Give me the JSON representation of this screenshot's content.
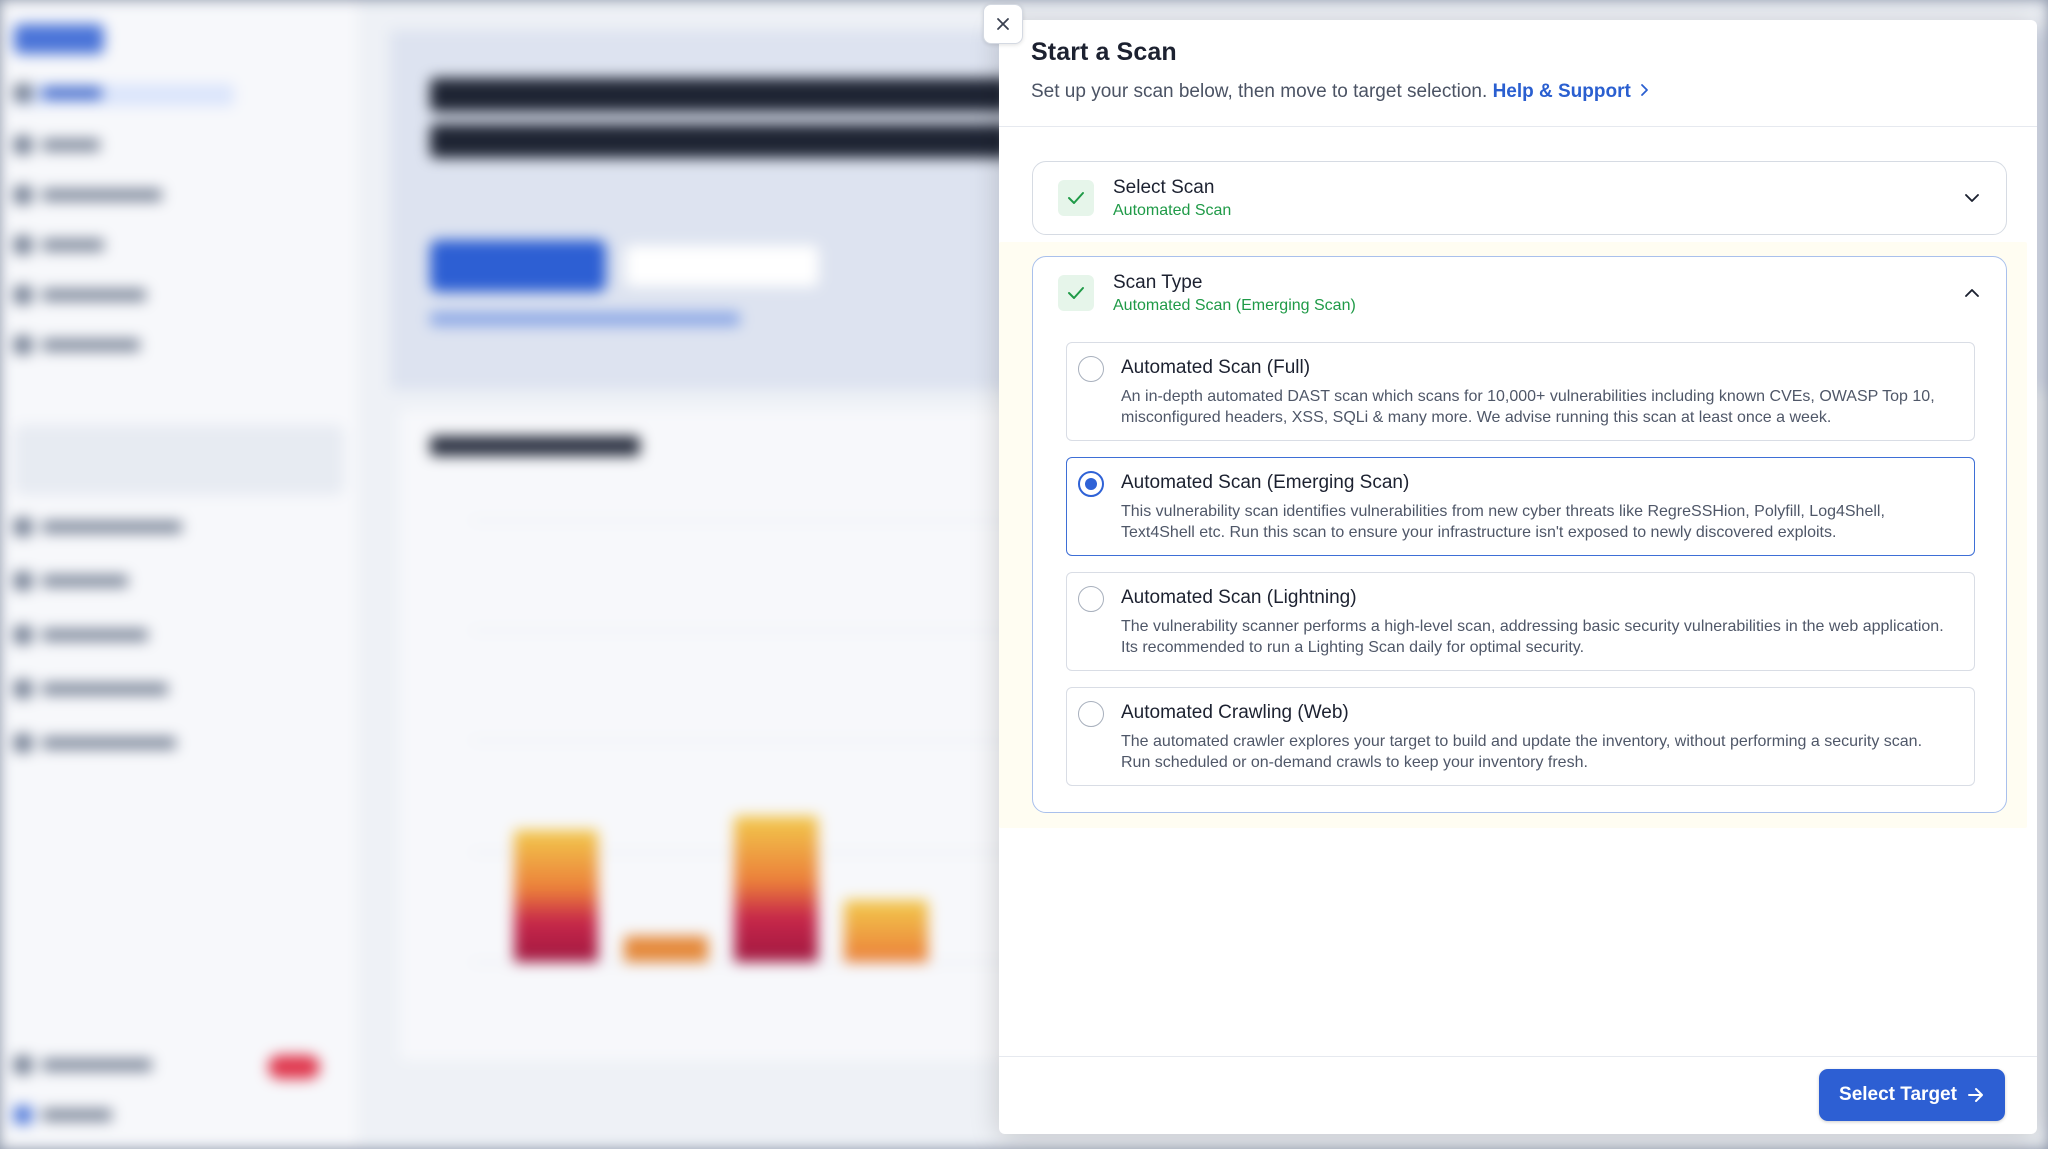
{
  "modal": {
    "title": "Start a Scan",
    "subtitle": "Set up your scan below, then move to target selection.",
    "help_link": "Help & Support"
  },
  "steps": [
    {
      "title": "Select Scan",
      "value": "Automated Scan",
      "state": "collapsed"
    },
    {
      "title": "Scan Type",
      "value": "Automated Scan (Emerging Scan)",
      "state": "expanded"
    }
  ],
  "scan_options": [
    {
      "title": "Automated Scan (Full)",
      "description": "An in-depth automated DAST scan which scans for 10,000+ vulnerabilities including known CVEs, OWASP Top 10, misconfigured headers, XSS, SQLi & many more. We advise running this scan at least once a week.",
      "selected": false
    },
    {
      "title": "Automated Scan (Emerging Scan)",
      "description": "This vulnerability scan identifies vulnerabilities from new cyber threats like RegreSSHion, Polyfill, Log4Shell, Text4Shell etc. Run this scan to ensure your infrastructure isn't exposed to newly discovered exploits.",
      "selected": true
    },
    {
      "title": "Automated Scan (Lightning)",
      "description": "The vulnerability scanner performs a high-level scan, addressing basic security vulnerabilities in the web application. Its recommended to run a Lighting Scan daily for optimal security.",
      "selected": false
    },
    {
      "title": "Automated Crawling (Web)",
      "description": "The automated crawler explores your target to build and update the inventory, without performing a security scan. Run scheduled or on-demand crawls to keep your inventory fresh.",
      "selected": false
    }
  ],
  "footer": {
    "primary_label": "Select Target"
  },
  "colors": {
    "accent": "#2d5fd3",
    "success": "#1f9a47",
    "highlight_border": "#a9c0ec"
  },
  "icons": {
    "close": "close-icon",
    "check": "check-icon",
    "chevron_down": "chevron-down-icon",
    "chevron_up": "chevron-up-icon",
    "arrow_right": "arrow-right-icon"
  }
}
